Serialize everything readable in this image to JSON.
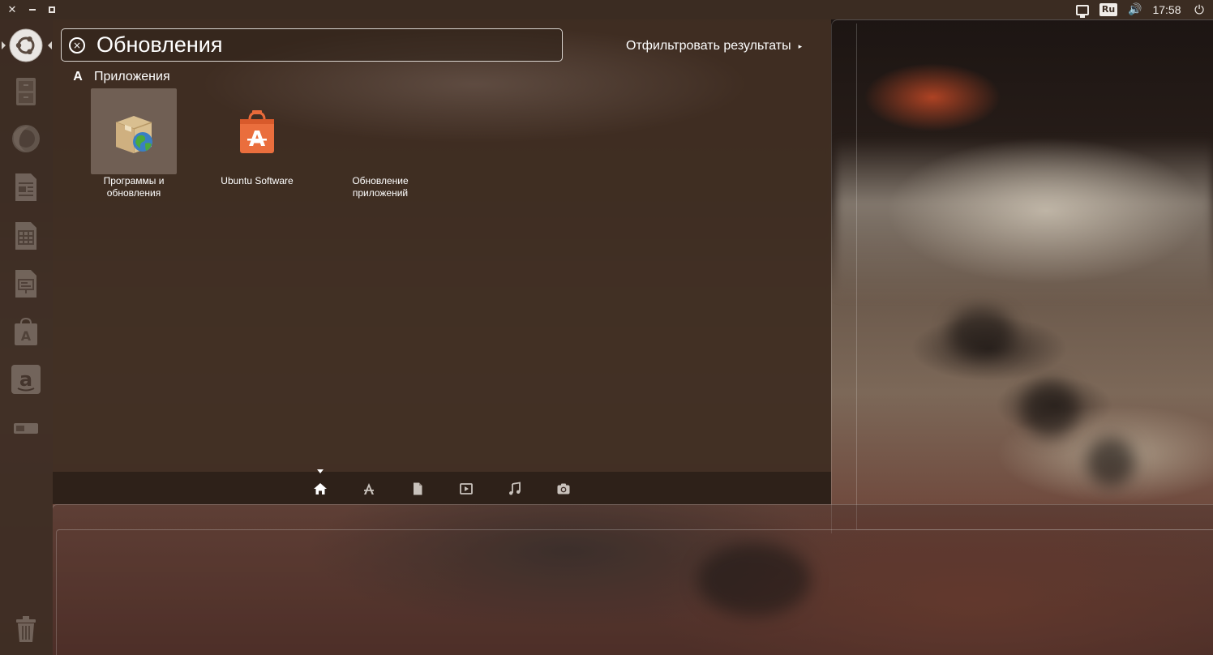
{
  "top_panel": {
    "window_buttons": {
      "close": "close-icon",
      "minimize": "minimize-icon",
      "maximize": "maximize-icon"
    },
    "indicators": {
      "network_icon": "network-icon",
      "keyboard_layout": "Ru",
      "volume_icon": "volume-icon",
      "volume_glyph": "🔊",
      "clock": "17:58",
      "session_icon": "power-icon",
      "session_glyph": "⏻"
    }
  },
  "launcher": {
    "items": [
      {
        "name": "dash-home",
        "icon": "ubuntu-logo-icon"
      },
      {
        "name": "files",
        "icon": "file-cabinet-icon"
      },
      {
        "name": "firefox",
        "icon": "firefox-icon"
      },
      {
        "name": "writer",
        "icon": "libreoffice-writer-icon"
      },
      {
        "name": "calc",
        "icon": "libreoffice-calc-icon"
      },
      {
        "name": "impress",
        "icon": "libreoffice-impress-icon"
      },
      {
        "name": "software",
        "icon": "ubuntu-software-icon"
      },
      {
        "name": "amazon",
        "icon": "amazon-icon",
        "glyph": "a"
      },
      {
        "name": "device",
        "icon": "drive-icon"
      },
      {
        "name": "trash",
        "icon": "trash-icon"
      }
    ]
  },
  "dash": {
    "search": {
      "value": "Обновления",
      "clear_glyph": "×"
    },
    "filter_label": "Отфильтровать результаты",
    "filter_arrow": "▸",
    "category": {
      "glyph": "A",
      "label": "Приложения"
    },
    "results": [
      {
        "label": "Программы и обновления",
        "icon": "software-properties-icon",
        "highlighted": true
      },
      {
        "label": "Ubuntu Software",
        "icon": "ubuntu-software-icon",
        "highlighted": false
      },
      {
        "label": "Обновление приложений",
        "icon": "update-manager-icon",
        "highlighted": false
      }
    ],
    "lenses": [
      {
        "name": "home",
        "icon": "home-icon",
        "glyph": "⌂",
        "active": true
      },
      {
        "name": "applications",
        "icon": "applications-icon",
        "glyph": "A"
      },
      {
        "name": "files",
        "icon": "files-icon",
        "glyph": "▮"
      },
      {
        "name": "video",
        "icon": "video-icon",
        "glyph": "▶"
      },
      {
        "name": "music",
        "icon": "music-icon",
        "glyph": "♫"
      },
      {
        "name": "photos",
        "icon": "camera-icon",
        "glyph": "◉"
      }
    ]
  }
}
